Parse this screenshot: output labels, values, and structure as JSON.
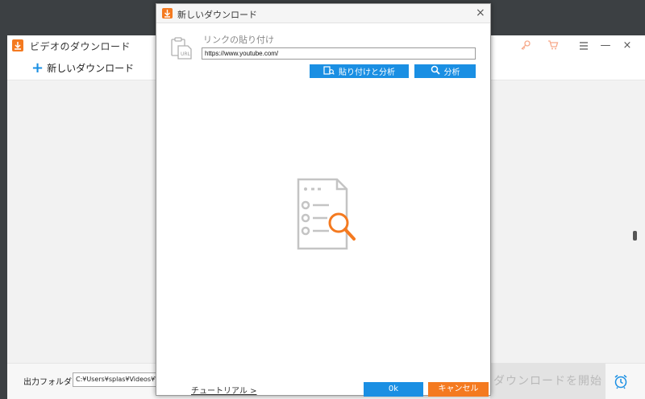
{
  "main_window": {
    "title": "ビデオのダウンロード",
    "toolbar": {
      "new_download_label": "新しいダウンロード"
    },
    "bottom": {
      "output_folder_label": "出力フォルダ：",
      "output_folder_path": "C:¥Users¥splas¥Videos¥Wond",
      "start_label": "ダウンロードを開始"
    }
  },
  "dialog": {
    "title": "新しいダウンロード",
    "paste_link_label": "リンクの貼り付け",
    "url_value": "https://www.youtube.com/",
    "paste_analyze_label": "貼り付けと分析",
    "analyze_label": "分析",
    "tutorial_label": "チュートリアル >",
    "ok_label": "0k",
    "cancel_label": "キャンセル"
  },
  "icons": {
    "close": "×",
    "minimize": "—",
    "maximize": "☐"
  },
  "colors": {
    "accent_blue": "#1a8fe3",
    "accent_orange": "#f47a20"
  }
}
